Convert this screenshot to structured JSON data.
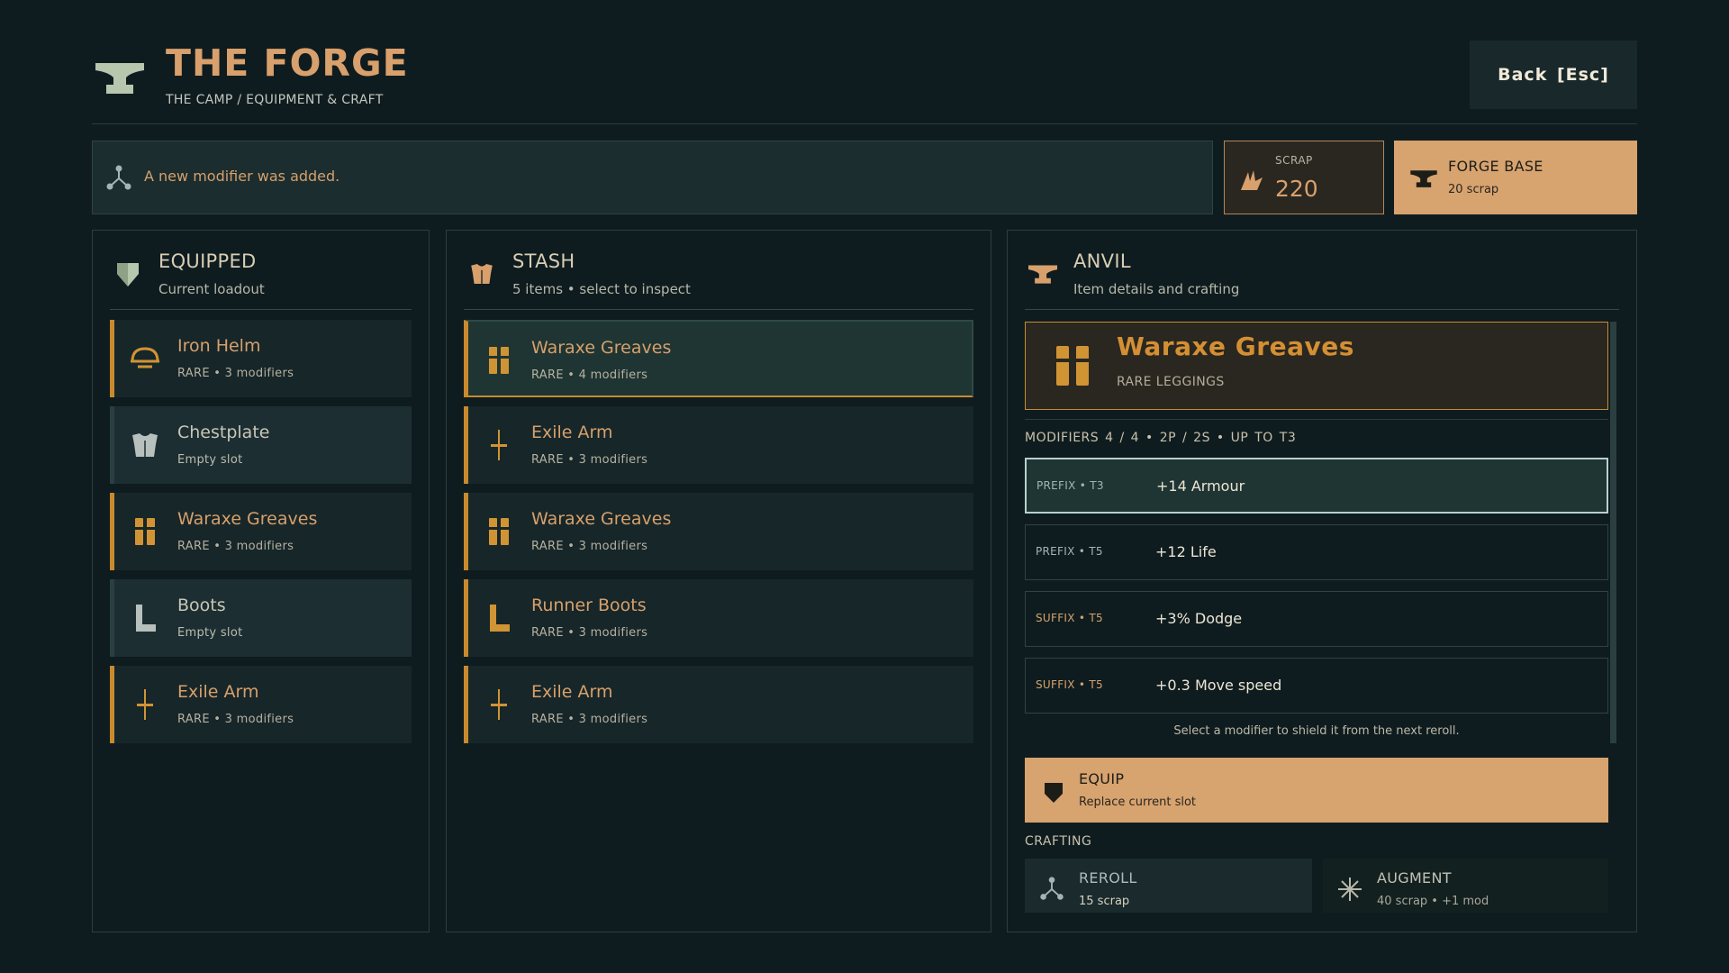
{
  "header": {
    "title": "THE FORGE",
    "breadcrumb": "THE CAMP / EQUIPMENT & CRAFT",
    "back_label": "Back  [Esc]"
  },
  "notice": {
    "text": "A new modifier was added.",
    "icon": "reroll-icon"
  },
  "scrap": {
    "label": "SCRAP",
    "value": "220",
    "icon": "scrap-icon"
  },
  "forge_base": {
    "title": "FORGE BASE",
    "cost": "20 scrap",
    "icon": "anvil-icon"
  },
  "colors": {
    "accent": "#d7a36f",
    "rare": "#c98a2e",
    "background": "#0f1c1f",
    "panel": "#172629"
  },
  "equipped": {
    "title": "EQUIPPED",
    "subtitle": "Current loadout",
    "items": [
      {
        "name": "Iron Helm",
        "meta": "RARE  •  3 modifiers",
        "icon": "helm-icon"
      },
      {
        "name": "Chestplate",
        "meta": "Empty slot",
        "icon": "chestplate-icon"
      },
      {
        "name": "Waraxe Greaves",
        "meta": "RARE  •  3 modifiers",
        "icon": "greaves-icon"
      },
      {
        "name": "Boots",
        "meta": "Empty slot",
        "icon": "boots-icon"
      },
      {
        "name": "Exile Arm",
        "meta": "RARE  •  3 modifiers",
        "icon": "sword-icon"
      }
    ]
  },
  "stash": {
    "title": "STASH",
    "subtitle": "5 items • select to inspect",
    "items": [
      {
        "name": "Waraxe Greaves",
        "meta": "RARE  •  4 modifiers",
        "icon": "greaves-icon"
      },
      {
        "name": "Exile Arm",
        "meta": "RARE  •  3 modifiers",
        "icon": "sword-icon"
      },
      {
        "name": "Waraxe Greaves",
        "meta": "RARE  •  3 modifiers",
        "icon": "greaves-icon"
      },
      {
        "name": "Runner Boots",
        "meta": "RARE  •  3 modifiers",
        "icon": "boots-icon"
      },
      {
        "name": "Exile Arm",
        "meta": "RARE  •  3 modifiers",
        "icon": "sword-icon"
      }
    ]
  },
  "anvil": {
    "title": "ANVIL",
    "subtitle": "Item details and crafting",
    "item_name": "Waraxe Greaves",
    "item_type": "RARE LEGGINGS",
    "modifiers_header": "MODIFIERS  4 / 4   •   2P / 2S   •   UP TO T3",
    "modifiers": [
      {
        "tier": "PREFIX • T3",
        "text": "+14 Armour"
      },
      {
        "tier": "PREFIX • T5",
        "text": "+12 Life"
      },
      {
        "tier": "SUFFIX • T5",
        "text": "+3% Dodge"
      },
      {
        "tier": "SUFFIX • T5",
        "text": "+0.3 Move speed"
      }
    ],
    "hint": "Select a modifier to shield it from the next reroll.",
    "equip": {
      "title": "EQUIP",
      "subtitle": "Replace current slot"
    },
    "crafting_label": "CRAFTING",
    "reroll": {
      "title": "REROLL",
      "cost": "15 scrap"
    },
    "augment": {
      "title": "AUGMENT",
      "cost": "40 scrap • +1 mod"
    }
  }
}
